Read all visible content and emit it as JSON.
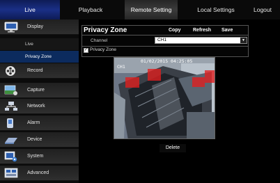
{
  "nav": {
    "tabs": [
      "Live",
      "Playback",
      "Remote Setting",
      "Local Settings",
      "Logout"
    ]
  },
  "sidebar": {
    "items": [
      {
        "label": "Display",
        "icon": "monitor-icon"
      },
      {
        "label": "Record",
        "icon": "film-reel-icon"
      },
      {
        "label": "Capture",
        "icon": "capture-icon"
      },
      {
        "label": "Network",
        "icon": "network-icon"
      },
      {
        "label": "Alarm",
        "icon": "alarm-icon"
      },
      {
        "label": "Device",
        "icon": "device-icon"
      },
      {
        "label": "System",
        "icon": "system-icon"
      },
      {
        "label": "Advanced",
        "icon": "advanced-icon"
      }
    ],
    "sub_items": [
      "Live",
      "Privacy Zone"
    ]
  },
  "panel": {
    "title": "Privacy Zone",
    "copy": "Copy",
    "refresh": "Refresh",
    "save": "Save",
    "channel_label": "Channel",
    "channel_value": "CH1",
    "privacy_zone_label": "Privacy Zone",
    "privacy_zone_checked": true
  },
  "video": {
    "channel": "CH1",
    "timestamp": "01/02/2015 04:25:05"
  },
  "delete_label": "Delete",
  "colors": {
    "active_tab": "#1a2f86",
    "highlight_tab": "#3b3b3b",
    "selected_sub_item": "#0c2b5e",
    "mask": "#e11e1e"
  }
}
